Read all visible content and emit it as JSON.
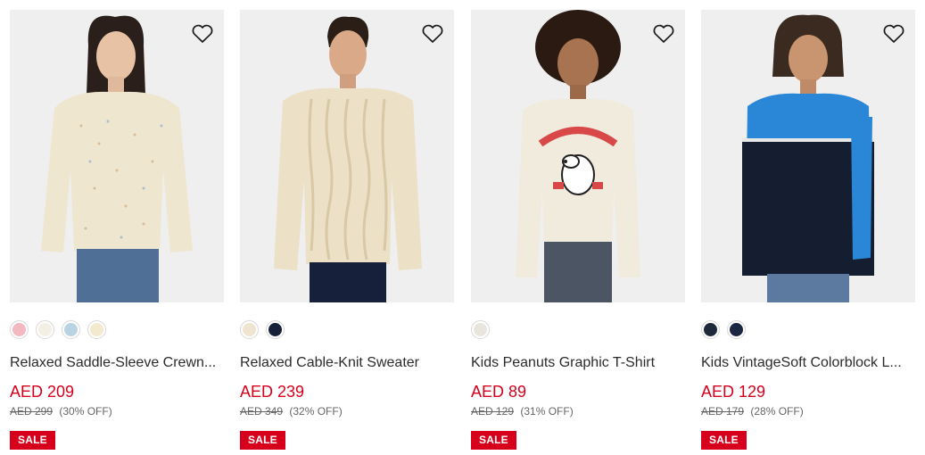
{
  "colors": {
    "price": "#d6001c",
    "sale_badge_bg": "#d6001c",
    "sale_badge_text": "#ffffff",
    "text": "#2b2b2b",
    "photo_bg": "#efefef"
  },
  "products": [
    {
      "name": "Relaxed Saddle-Sleeve Crewn...",
      "price": "AED 209",
      "original_price": "AED 299",
      "discount": "(30% OFF)",
      "badge": "SALE",
      "wishlist_icon": "heart-outline-icon",
      "swatches": [
        "#f4b8c1",
        "#f3efe4",
        "#b9d3e3",
        "#f2e9cf"
      ]
    },
    {
      "name": "Relaxed Cable-Knit Sweater",
      "price": "AED 239",
      "original_price": "AED 349",
      "discount": "(32% OFF)",
      "badge": "SALE",
      "wishlist_icon": "heart-outline-icon",
      "swatches": [
        "#efe4cf",
        "#18213a"
      ]
    },
    {
      "name": "Kids Peanuts Graphic T-Shirt",
      "price": "AED 89",
      "original_price": "AED 129",
      "discount": "(31% OFF)",
      "badge": "SALE",
      "wishlist_icon": "heart-outline-icon",
      "swatches": [
        "#e8e6dc"
      ]
    },
    {
      "name": "Kids VintageSoft Colorblock L...",
      "price": "AED 129",
      "original_price": "AED 179",
      "discount": "(28% OFF)",
      "badge": "SALE",
      "wishlist_icon": "heart-outline-icon",
      "swatches": [
        "#1e2a3c",
        "#1b2640"
      ]
    }
  ]
}
